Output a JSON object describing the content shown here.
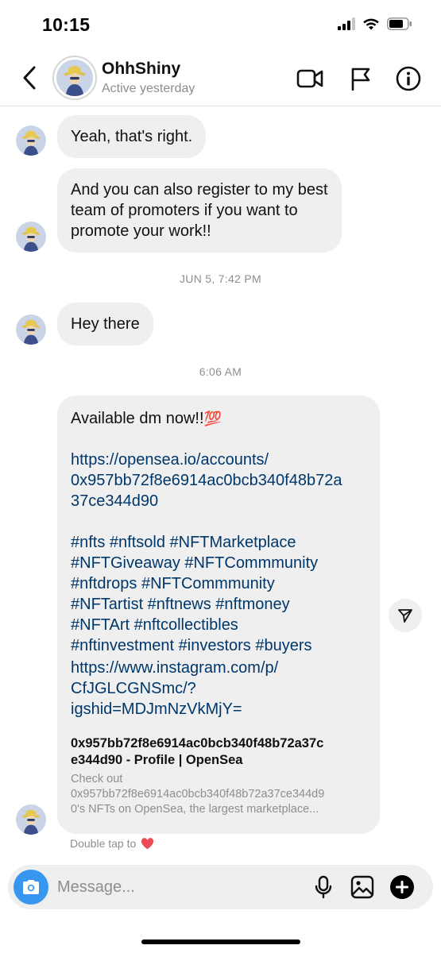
{
  "status_bar": {
    "time": "10:15"
  },
  "header": {
    "name": "OhhShiny",
    "status": "Active yesterday",
    "icons": [
      "chevron-left-icon",
      "video-icon",
      "flag-icon",
      "info-icon"
    ]
  },
  "messages": [
    {
      "type": "text",
      "lines": [
        "Yeah, that's right."
      ]
    },
    {
      "type": "text",
      "lines": [
        "And you can also register to my best",
        "team of promoters if you want to",
        "promote your work!!"
      ]
    },
    {
      "type": "timestamp",
      "text": "JUN 5, 7:42 PM"
    },
    {
      "type": "text",
      "lines": [
        "Hey there"
      ]
    },
    {
      "type": "timestamp",
      "text": "6:06 AM"
    }
  ],
  "big_message": {
    "first_line": "Available dm now!!",
    "first_line_emoji": "💯",
    "url_lines": [
      "https://opensea.io/accounts/",
      "0x957bb72f8e6914ac0bcb340f48b72a",
      "37ce344d90"
    ],
    "hashtag_lines": [
      "#nfts #nftsold #NFTMarketplace",
      "#NFTGiveaway #NFTCommmunity",
      "#nftdrops #NFTCommmunity",
      "#NFTartist #nftnews #nftmoney",
      "#NFTArt #nftcollectibles",
      "#nftinvestment #investors #buyers"
    ],
    "url2_lines": [
      "https://www.instagram.com/p/",
      "CfJGLCGNSmc/?",
      "igshid=MDJmNzVkMjY="
    ],
    "preview_title_lines": [
      "0x957bb72f8e6914ac0bcb340f48b72a37c",
      "e344d90 - Profile | OpenSea"
    ],
    "preview_desc_lines": [
      "Check out",
      "0x957bb72f8e6914ac0bcb340f48b72a37ce344d9",
      "0's NFTs on OpenSea, the largest marketplace..."
    ]
  },
  "double_tap": {
    "text": "Double tap to",
    "icon": "heart-icon"
  },
  "composer": {
    "placeholder": "Message...",
    "icons": [
      "camera-icon",
      "microphone-icon",
      "image-icon",
      "plus-icon"
    ]
  },
  "colors": {
    "accent": "#3797f0",
    "bubble": "#efefef",
    "link": "#00376b",
    "muted": "#8e8e8e"
  }
}
